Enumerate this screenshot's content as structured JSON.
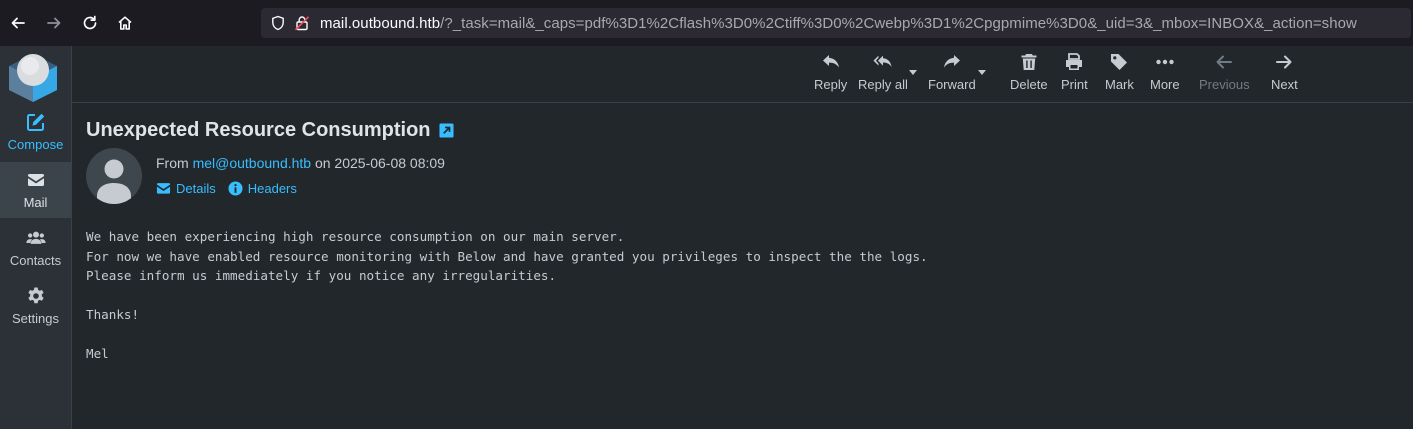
{
  "browser": {
    "url_domain": "mail.outbound.htb",
    "url_path": "/?_task=mail&_caps=pdf%3D1%2Cflash%3D0%2Ctiff%3D0%2Cwebp%3D1%2Cpgpmime%3D0&_uid=3&_mbox=INBOX&_action=show"
  },
  "rail": {
    "items": [
      {
        "label": "Compose",
        "icon": "compose-icon"
      },
      {
        "label": "Mail",
        "icon": "envelope-icon"
      },
      {
        "label": "Contacts",
        "icon": "users-icon"
      },
      {
        "label": "Settings",
        "icon": "gear-icon"
      }
    ]
  },
  "toolbar": {
    "reply": "Reply",
    "reply_all": "Reply all",
    "forward": "Forward",
    "delete": "Delete",
    "print": "Print",
    "mark": "Mark",
    "more": "More",
    "previous": "Previous",
    "next": "Next"
  },
  "message": {
    "subject": "Unexpected Resource Consumption",
    "from_prefix": "From ",
    "from_address": "mel@outbound.htb",
    "date_text": " on 2025-06-08 08:09",
    "details_label": "Details",
    "headers_label": "Headers",
    "body_lines": [
      "We have been experiencing high resource consumption on our main server.",
      "For now we have enabled resource monitoring with Below and have granted you privileges to inspect the the logs.",
      "Please inform us immediately if you notice any irregularities.",
      "",
      "Thanks!",
      "",
      "Mel"
    ]
  },
  "colors": {
    "accent": "#37beff",
    "background": "#22272b",
    "rail": "#2b3136",
    "selected": "#3b444b"
  }
}
